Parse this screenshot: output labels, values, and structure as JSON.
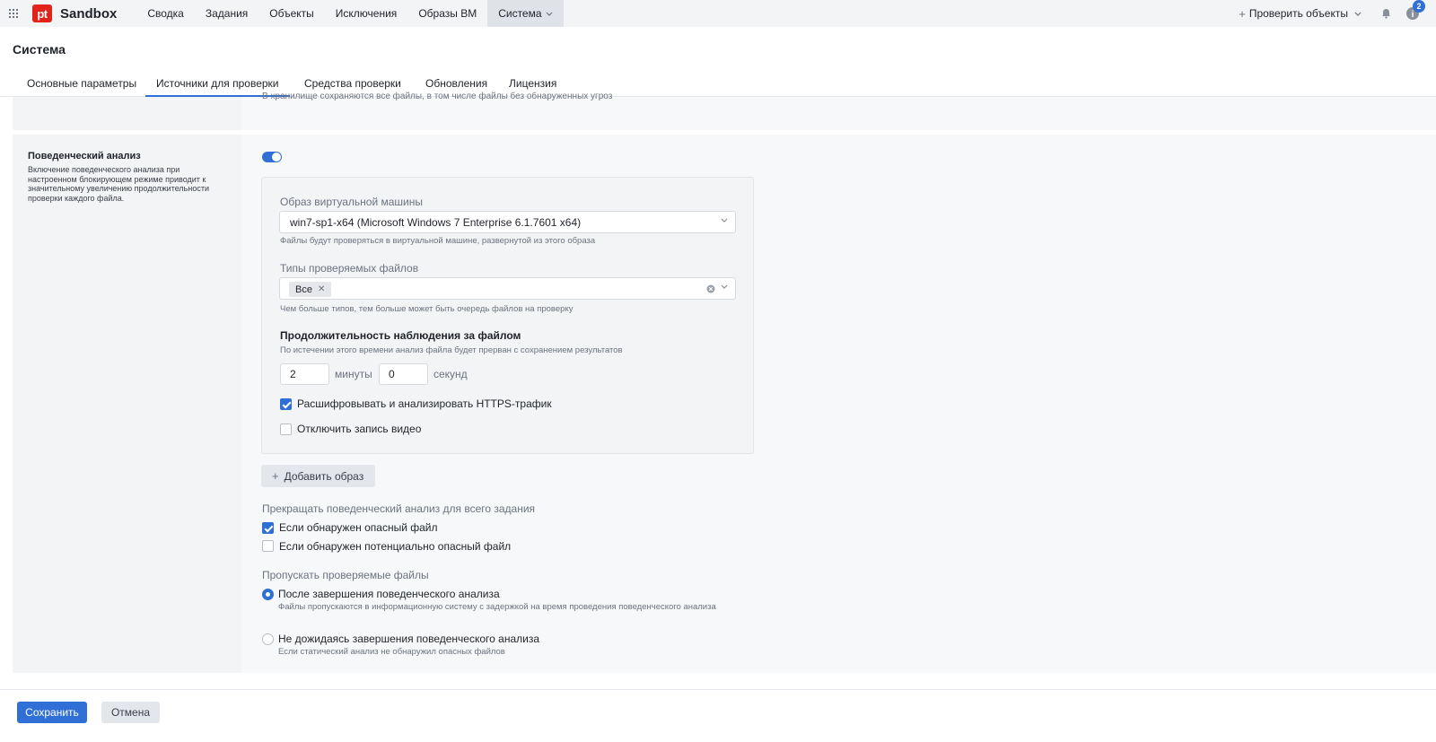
{
  "app": {
    "logo": "pt",
    "name": "Sandbox"
  },
  "nav": {
    "items": [
      "Сводка",
      "Задания",
      "Объекты",
      "Исключения",
      "Образы ВМ",
      "Система"
    ],
    "active": "Система",
    "check_objects": "Проверить объекты",
    "help_badge": "2"
  },
  "page": {
    "title": "Система",
    "tabs": [
      "Основные параметры",
      "Источники для проверки",
      "Средства проверки",
      "Обновления",
      "Лицензия"
    ],
    "active_tab": "Источники для проверки",
    "clipped_text": "В хранилище сохраняются все файлы, в том числе файлы без обнаруженных угроз"
  },
  "section": {
    "title": "Поведенческий анализ",
    "description": "Включение поведенческого анализа при настроенном блокирующем режиме приводит к значительному увеличению продолжительности проверки каждого файла.",
    "toggle_enabled": true
  },
  "vm_card": {
    "image_label": "Образ виртуальной машины",
    "image_value": "win7-sp1-x64 (Microsoft Windows 7 Enterprise 6.1.7601 x64)",
    "image_hint": "Файлы будут проверяться в виртуальной машине, развернутой из этого образа",
    "types_label": "Типы проверяемых файлов",
    "types_chip": "Все",
    "types_hint": "Чем больше типов, тем больше может быть очередь файлов на проверку",
    "duration_title": "Продолжительность наблюдения за файлом",
    "duration_hint": "По истечении этого времени анализ файла будет прерван с сохранением результатов",
    "minutes_value": "2",
    "minutes_unit": "минуты",
    "seconds_value": "0",
    "seconds_unit": "секунд",
    "https_label": "Расшифровывать и анализировать HTTPS-трафик",
    "https_checked": true,
    "video_label": "Отключить запись видео",
    "video_checked": false
  },
  "add_image_label": "Добавить образ",
  "stop_analysis": {
    "label": "Прекращать поведенческий анализ для всего задания",
    "opt1": "Если обнаружен опасный файл",
    "opt1_checked": true,
    "opt2": "Если обнаружен потенциально опасный файл",
    "opt2_checked": false
  },
  "skip_files": {
    "label": "Пропускать проверяемые файлы",
    "opt1": "После завершения поведенческого анализа",
    "opt1_hint": "Файлы пропускаются в информационную систему с задержкой на время проведения поведенческого анализа",
    "opt2": "Не дожидаясь завершения поведенческого анализа",
    "opt2_hint": "Если статический анализ не обнаружил опасных файлов",
    "selected": "opt1"
  },
  "footer": {
    "save": "Сохранить",
    "cancel": "Отмена"
  },
  "colors": {
    "accent": "#2f6fd6",
    "brand": "#e2231a"
  }
}
